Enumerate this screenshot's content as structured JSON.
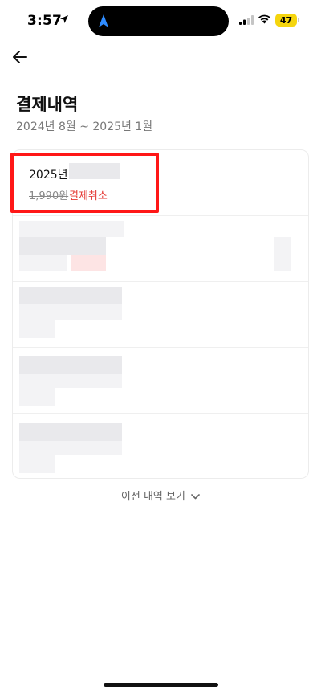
{
  "status_bar": {
    "time": "3:57",
    "battery": "47",
    "battery_color": "#f5d50e"
  },
  "header": {
    "back_icon": "arrow-left-icon",
    "title": "결제내역",
    "period": "2024년 8월 ~ 2025년 1월"
  },
  "payments": [
    {
      "year": "2025년",
      "price": "1,990원",
      "status": "결제취소",
      "status_color": "#e53935"
    }
  ],
  "more_label": "이전 내역 보기",
  "accent_highlight": "#ff1717"
}
